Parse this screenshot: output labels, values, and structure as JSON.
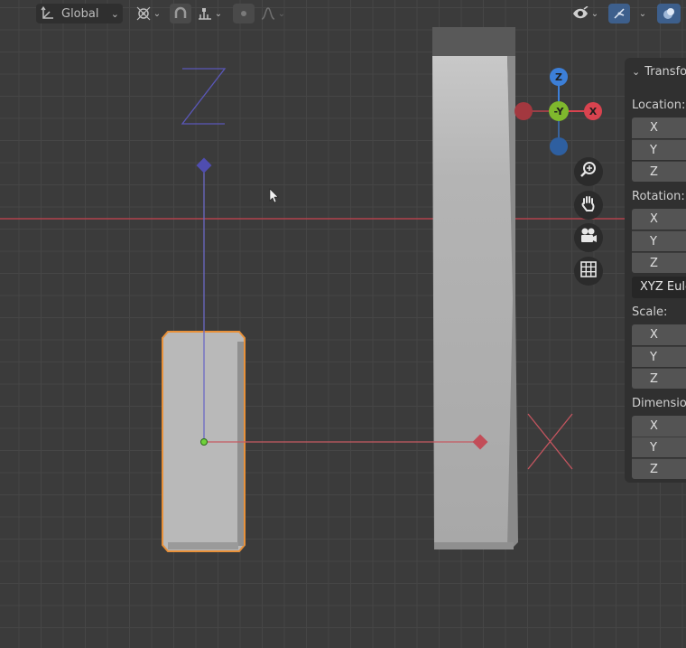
{
  "header": {
    "orientation_label": "Global",
    "icons": [
      "transform-orientation-icon",
      "pivot-point-icon",
      "snap-icon",
      "snap-target-icon",
      "proportional-edit-icon",
      "falloff-icon",
      "visibility-icon",
      "gizmo-icon",
      "overlay-icon"
    ]
  },
  "viewport": {
    "z_letter": "Z",
    "x_letter": "X",
    "gridline_color": "#464646",
    "selection_color": "#e8913a",
    "x_axis_color": "#c34a55",
    "z_axis_color": "#5a57b8"
  },
  "gizmo": {
    "z_label": "Z",
    "y_label": "-Y",
    "x_label": "X",
    "x_color": "#d9434f",
    "y_color": "#7fb82d",
    "z_color": "#3c7fd8"
  },
  "nav": [
    "zoom-icon",
    "pan-hand-icon",
    "camera-icon",
    "grid-perspective-icon"
  ],
  "sidebar": {
    "title": "Transfo",
    "location_label": "Location:",
    "rotation_label": "Rotation:",
    "scale_label": "Scale:",
    "dimensions_label": "Dimensio",
    "rotation_mode": "XYZ Eule",
    "axes": [
      "X",
      "Y",
      "Z"
    ]
  }
}
